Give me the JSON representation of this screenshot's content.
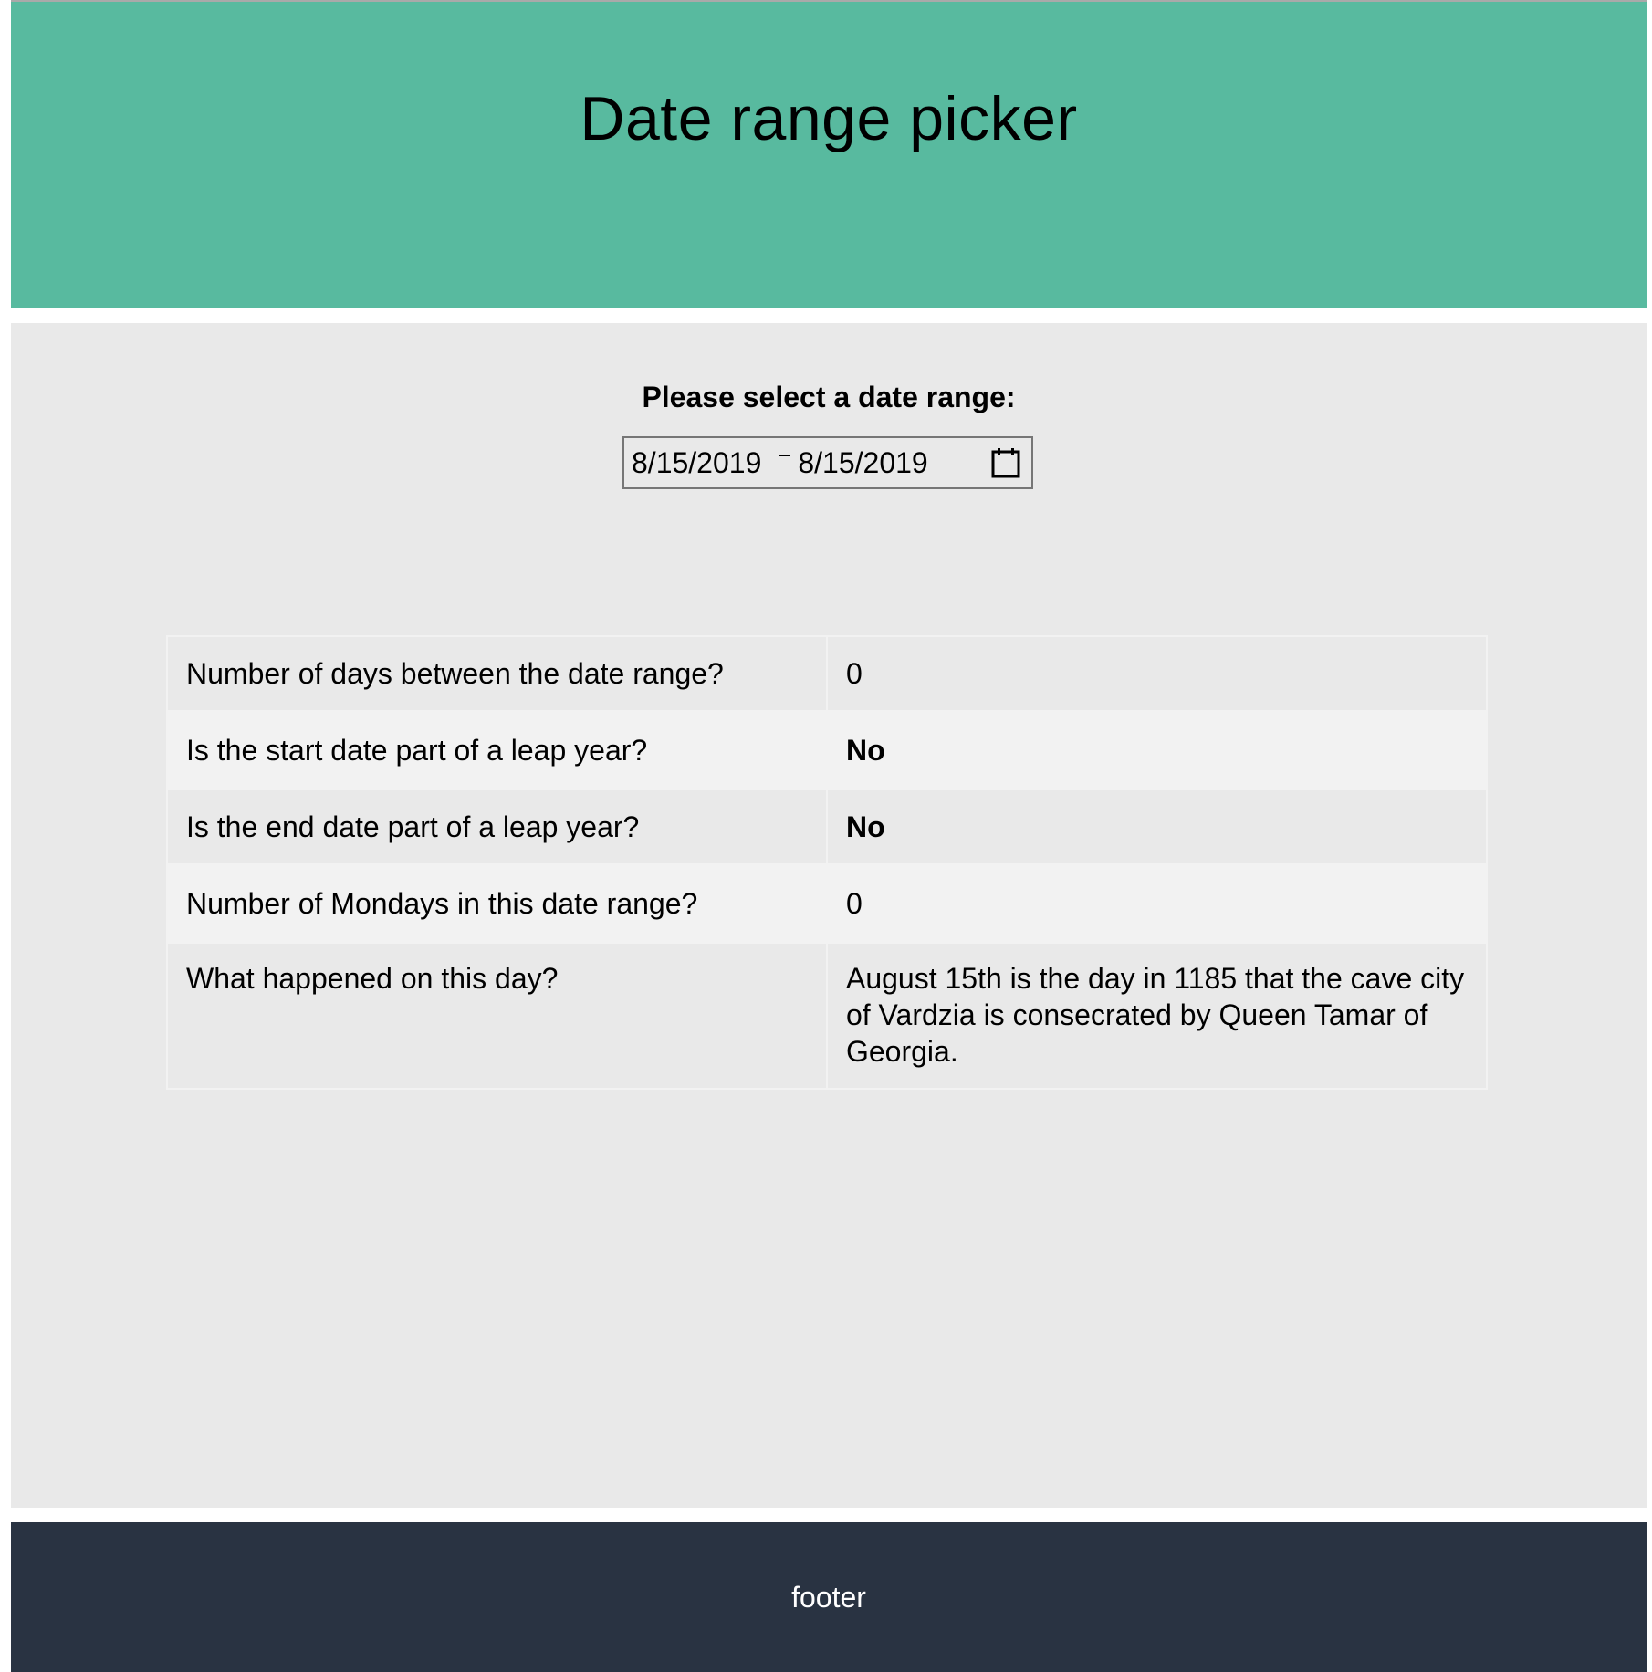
{
  "colors": {
    "header_bg": "#58ba9f",
    "main_bg": "#e9e9e9",
    "footer_bg": "#293342",
    "footer_text": "#ffffff"
  },
  "header": {
    "title": "Date range picker"
  },
  "picker": {
    "label": "Please select a date range:",
    "start_date": "8/15/2019",
    "end_date": "8/15/2019",
    "icon": "calendar-icon"
  },
  "results": {
    "rows": [
      {
        "question": "Number of days between the date range?",
        "answer": "0"
      },
      {
        "question": "Is the start date part of a leap year?",
        "answer": "No"
      },
      {
        "question": "Is the end date part of a leap year?",
        "answer": "No"
      },
      {
        "question": "Number of Mondays in this date range?",
        "answer": "0"
      },
      {
        "question": "What happened on this day?",
        "answer": "August 15th is the day in 1185 that the cave city of Vardzia is consecrated by Queen Tamar of Georgia."
      }
    ]
  },
  "footer": {
    "text": "footer"
  }
}
